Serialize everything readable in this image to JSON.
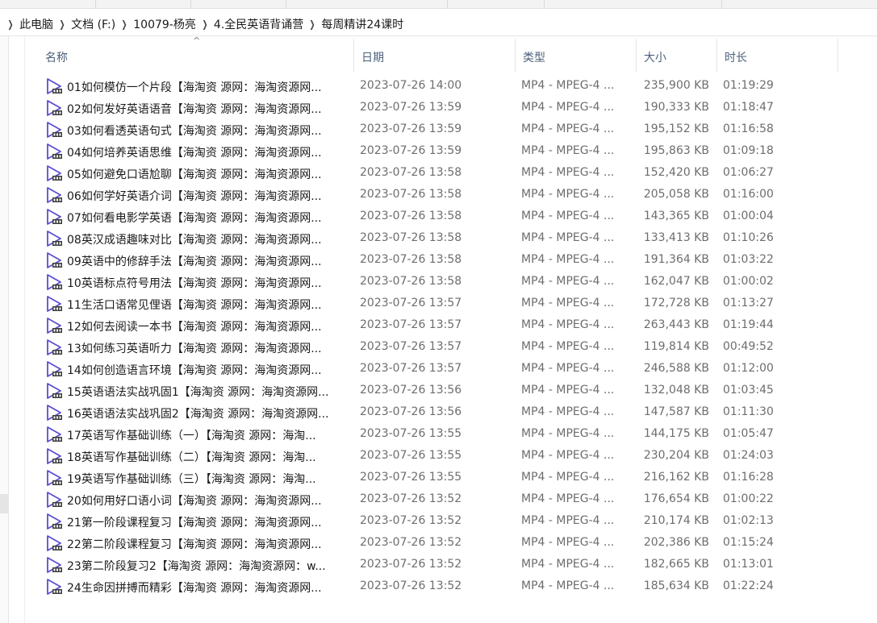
{
  "address_bar": {
    "breadcrumbs": [
      "此电脑",
      "文档 (F:)",
      "10079-杨亮",
      "4.全民英语背诵营",
      "每周精讲24课时"
    ]
  },
  "columns": {
    "name": "名称",
    "date": "日期",
    "type": "类型",
    "size": "大小",
    "duration": "时长"
  },
  "files": [
    {
      "name": "01如何模仿一个片段【海淘资 源网：海淘资源网...",
      "date": "2023-07-26 14:00",
      "type": "MP4 - MPEG-4 ...",
      "size": "235,900 KB",
      "duration": "01:19:29"
    },
    {
      "name": "02如何发好英语语音【海淘资 源网：海淘资源网...",
      "date": "2023-07-26 13:59",
      "type": "MP4 - MPEG-4 ...",
      "size": "190,333 KB",
      "duration": "01:18:47"
    },
    {
      "name": "03如何看透英语句式【海淘资 源网：海淘资源网...",
      "date": "2023-07-26 13:59",
      "type": "MP4 - MPEG-4 ...",
      "size": "195,152 KB",
      "duration": "01:16:58"
    },
    {
      "name": "04如何培养英语思维【海淘资 源网：海淘资源网...",
      "date": "2023-07-26 13:59",
      "type": "MP4 - MPEG-4 ...",
      "size": "195,863 KB",
      "duration": "01:09:18"
    },
    {
      "name": "05如何避免口语尬聊【海淘资 源网：海淘资源网...",
      "date": "2023-07-26 13:58",
      "type": "MP4 - MPEG-4 ...",
      "size": "152,420 KB",
      "duration": "01:06:27"
    },
    {
      "name": "06如何学好英语介词【海淘资 源网：海淘资源网...",
      "date": "2023-07-26 13:58",
      "type": "MP4 - MPEG-4 ...",
      "size": "205,058 KB",
      "duration": "01:16:00"
    },
    {
      "name": "07如何看电影学英语【海淘资 源网：海淘资源网...",
      "date": "2023-07-26 13:58",
      "type": "MP4 - MPEG-4 ...",
      "size": "143,365 KB",
      "duration": "01:00:04"
    },
    {
      "name": "08英汉成语趣味对比【海淘资 源网：海淘资源网...",
      "date": "2023-07-26 13:58",
      "type": "MP4 - MPEG-4 ...",
      "size": "133,413 KB",
      "duration": "01:10:26"
    },
    {
      "name": "09英语中的修辞手法【海淘资 源网：海淘资源网...",
      "date": "2023-07-26 13:58",
      "type": "MP4 - MPEG-4 ...",
      "size": "191,364 KB",
      "duration": "01:03:22"
    },
    {
      "name": "10英语标点符号用法【海淘资 源网：海淘资源网...",
      "date": "2023-07-26 13:58",
      "type": "MP4 - MPEG-4 ...",
      "size": "162,047 KB",
      "duration": "01:00:02"
    },
    {
      "name": "11生活口语常见俚语【海淘资 源网：海淘资源网...",
      "date": "2023-07-26 13:57",
      "type": "MP4 - MPEG-4 ...",
      "size": "172,728 KB",
      "duration": "01:13:27"
    },
    {
      "name": "12如何去阅读一本书【海淘资 源网：海淘资源网...",
      "date": "2023-07-26 13:57",
      "type": "MP4 - MPEG-4 ...",
      "size": "263,443 KB",
      "duration": "01:19:44"
    },
    {
      "name": "13如何练习英语听力【海淘资 源网：海淘资源网...",
      "date": "2023-07-26 13:57",
      "type": "MP4 - MPEG-4 ...",
      "size": "119,814 KB",
      "duration": "00:49:52"
    },
    {
      "name": "14如何创造语言环境【海淘资 源网：海淘资源网...",
      "date": "2023-07-26 13:57",
      "type": "MP4 - MPEG-4 ...",
      "size": "246,588 KB",
      "duration": "01:12:00"
    },
    {
      "name": "15英语语法实战巩固1【海淘资 源网：海淘资源网...",
      "date": "2023-07-26 13:56",
      "type": "MP4 - MPEG-4 ...",
      "size": "132,048 KB",
      "duration": "01:03:45"
    },
    {
      "name": "16英语语法实战巩固2【海淘资 源网：海淘资源网...",
      "date": "2023-07-26 13:56",
      "type": "MP4 - MPEG-4 ...",
      "size": "147,587 KB",
      "duration": "01:11:30"
    },
    {
      "name": "17英语写作基础训练（一）【海淘资 源网：海淘...",
      "date": "2023-07-26 13:55",
      "type": "MP4 - MPEG-4 ...",
      "size": "144,175 KB",
      "duration": "01:05:47"
    },
    {
      "name": "18英语写作基础训练（二）【海淘资 源网：海淘...",
      "date": "2023-07-26 13:55",
      "type": "MP4 - MPEG-4 ...",
      "size": "230,204 KB",
      "duration": "01:24:03"
    },
    {
      "name": "19英语写作基础训练（三）【海淘资 源网：海淘...",
      "date": "2023-07-26 13:55",
      "type": "MP4 - MPEG-4 ...",
      "size": "216,162 KB",
      "duration": "01:16:28"
    },
    {
      "name": "20如何用好口语小词【海淘资 源网：海淘资源网...",
      "date": "2023-07-26 13:52",
      "type": "MP4 - MPEG-4 ...",
      "size": "176,654 KB",
      "duration": "01:00:22"
    },
    {
      "name": "21第一阶段课程复习【海淘资 源网：海淘资源网...",
      "date": "2023-07-26 13:52",
      "type": "MP4 - MPEG-4 ...",
      "size": "210,174 KB",
      "duration": "01:02:13"
    },
    {
      "name": "22第二阶段课程复习【海淘资 源网：海淘资源网...",
      "date": "2023-07-26 13:52",
      "type": "MP4 - MPEG-4 ...",
      "size": "202,386 KB",
      "duration": "01:15:24"
    },
    {
      "name": "23第二阶段复习2【海淘资 源网：海淘资源网：w...",
      "date": "2023-07-26 13:52",
      "type": "MP4 - MPEG-4 ...",
      "size": "182,665 KB",
      "duration": "01:13:01"
    },
    {
      "name": "24生命因拼搏而精彩【海淘资 源网：海淘资源网...",
      "date": "2023-07-26 13:52",
      "type": "MP4 - MPEG-4 ...",
      "size": "185,634 KB",
      "duration": "01:22:24"
    }
  ],
  "icons": {
    "file": "video-file-icon",
    "separator": "chevron-right-icon",
    "sort": "sort-up-icon"
  },
  "colors": {
    "header_text": "#4c607a",
    "icon_accent": "#5a4fcf",
    "meta_text": "#6d6d6d"
  }
}
